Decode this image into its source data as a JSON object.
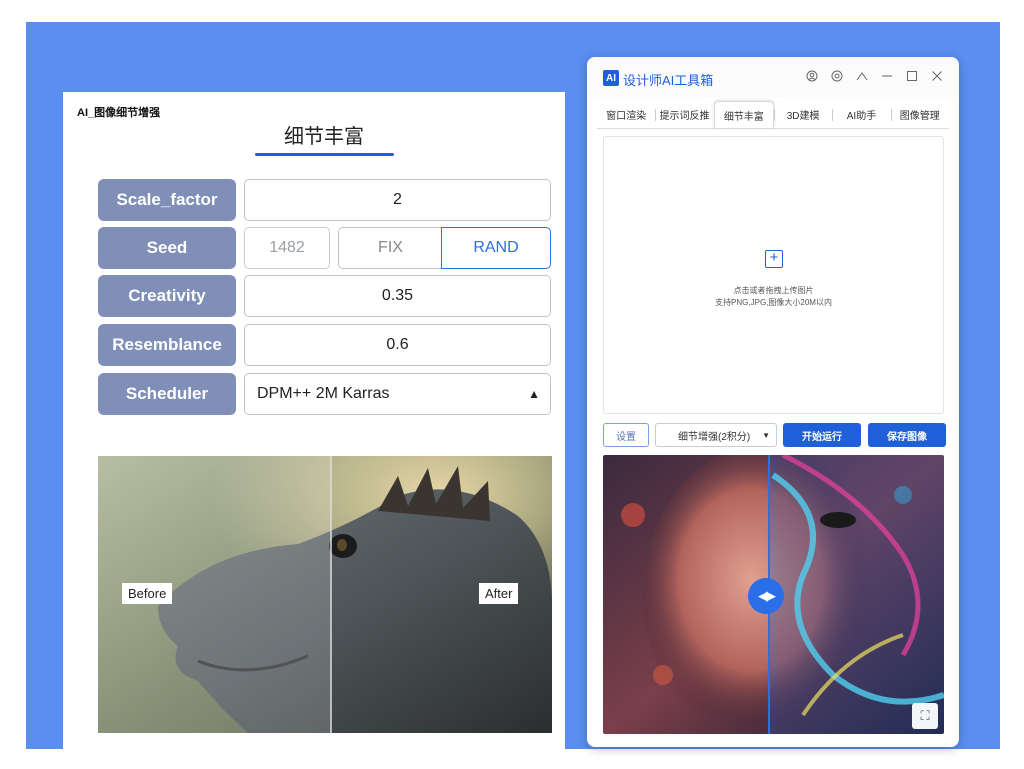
{
  "left_panel": {
    "title": "AI_图像细节增强",
    "tab_label": "细节丰富",
    "params": {
      "scale_factor": {
        "label": "Scale_factor",
        "value": "2"
      },
      "seed": {
        "label": "Seed",
        "value": "1482",
        "fix_label": "FIX",
        "rand_label": "RAND",
        "selected": "RAND"
      },
      "creativity": {
        "label": "Creativity",
        "value": "0.35"
      },
      "resemblance": {
        "label": "Resemblance",
        "value": "0.6"
      },
      "scheduler": {
        "label": "Scheduler",
        "value": "DPM++ 2M Karras"
      }
    },
    "compare": {
      "before_label": "Before",
      "after_label": "After"
    }
  },
  "app": {
    "logo": "AI",
    "title": "设计师AI工具箱",
    "window_controls": [
      "user-icon",
      "settings-icon",
      "pin-icon",
      "minimize-icon",
      "maximize-icon",
      "close-icon"
    ],
    "tabs": [
      {
        "label": "窗口渲染",
        "active": false
      },
      {
        "label": "提示词反推",
        "active": false
      },
      {
        "label": "细节丰富",
        "active": true
      },
      {
        "label": "3D建模",
        "active": false
      },
      {
        "label": "AI助手",
        "active": false
      },
      {
        "label": "图像管理",
        "active": false
      }
    ],
    "upload": {
      "hint_line1": "点击或者拖拽上传图片",
      "hint_line2": "支持PNG,JPG,图像大小20M以内"
    },
    "controls": {
      "settings_label": "设置",
      "mode_value": "细节增强(2积分)",
      "run_label": "开始运行",
      "save_label": "保存图像"
    }
  },
  "colors": {
    "backdrop": "#5a8ff0",
    "accent": "#1f5fd8",
    "param_label_bg": "#7f8fb8"
  }
}
